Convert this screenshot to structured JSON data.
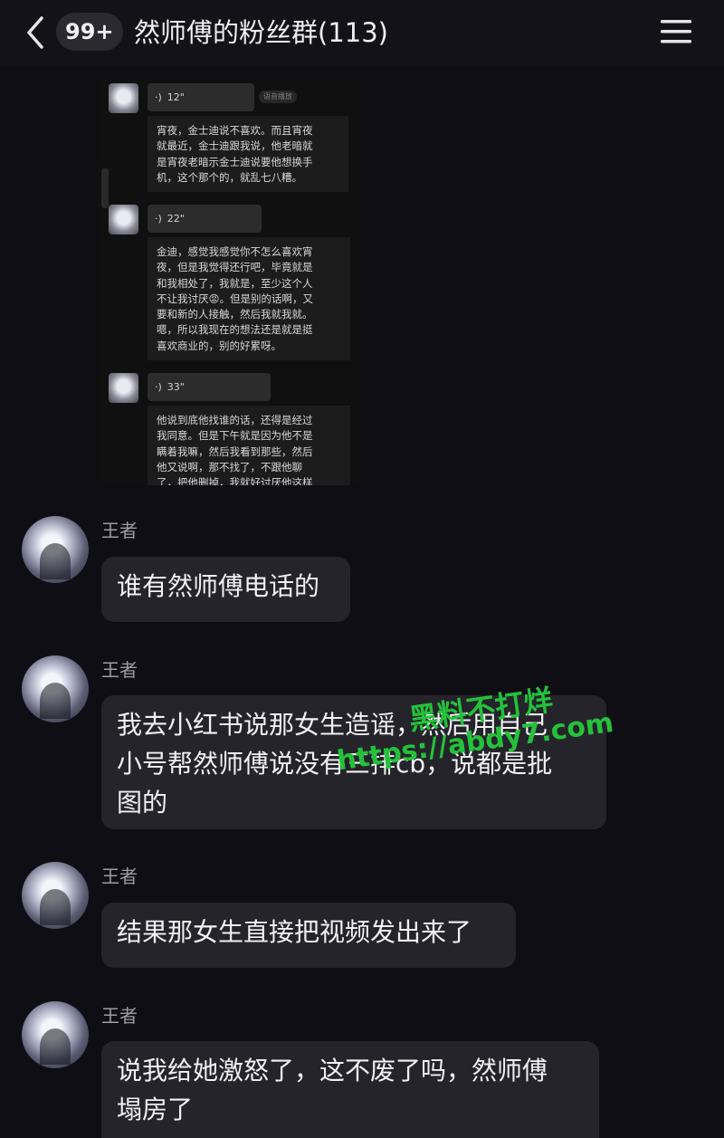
{
  "header": {
    "badge": "99+",
    "title": "然师傅的粉丝群(113)"
  },
  "embedded_screenshot": {
    "voice_messages": [
      {
        "duration": "12\"",
        "tag": "语音播放",
        "transcript": "宵夜，金士迪说不喜欢。而且宵夜\n就最近，金士迪跟我说，他老暗就\n是宵夜老暗示金士迪说要他想换手\n机，这个那个的，就乱七八糟。"
      },
      {
        "duration": "22\"",
        "transcript": "金迪，感觉我感觉你不怎么喜欢宵\n夜，但是我觉得还行吧，毕竟就是\n和我相处了，我就是，至少这个人\n不让我讨厌😡。但是别的话啊，又\n要和新的人接触，然后我就我就。\n嗯，所以我现在的想法还是就是挺\n喜欢商业的，别的好累呀。"
      },
      {
        "duration": "33\"",
        "transcript": "他说到底他找谁的话，还得是经过\n我同意。但是下午就是因为他不是\n瞒着我嘛，然后我看到那些，然后\n他又说啊，那不找了，不跟他聊\n了，把他删掉，我就好讨厌他这样"
      }
    ]
  },
  "messages": [
    {
      "sender": "王者",
      "text": "谁有然师傅电话的"
    },
    {
      "sender": "王者",
      "text": "我去小红书说那女生造谣，然后用自己\n小号帮然师傅说没有三排cb，说都是批\n图的"
    },
    {
      "sender": "王者",
      "text": "结果那女生直接把视频发出来了"
    },
    {
      "sender": "王者",
      "text": "说我给她激怒了，这不废了吗，然师傅\n塌房了"
    }
  ],
  "watermark": {
    "line1": "黑料不打烊",
    "line2": "https://abdy7.com"
  },
  "icons": {
    "back": "chevron-left-icon",
    "menu": "hamburger-menu-icon",
    "voice": "voice-wave-icon"
  },
  "colors": {
    "background": "#0f0e14",
    "bubble": "#25242b",
    "watermark": "#24c23a"
  }
}
